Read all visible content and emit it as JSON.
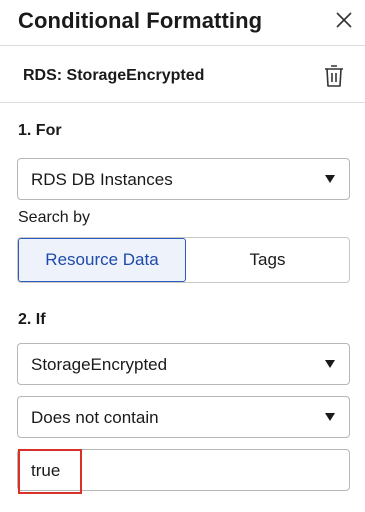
{
  "panel": {
    "title": "Conditional Formatting",
    "rule_name": "RDS: StorageEncrypted"
  },
  "for_section": {
    "label": "1. For",
    "resource_type": "RDS DB Instances",
    "search_by_label": "Search by",
    "toggle": {
      "options": [
        "Resource Data",
        "Tags"
      ],
      "selected": "Resource Data"
    }
  },
  "if_section": {
    "label": "2. If",
    "field": "StorageEncrypted",
    "operator": "Does not contain",
    "value": "true"
  },
  "colors": {
    "accent": "#2d5bb9",
    "highlight": "#d9302a"
  }
}
